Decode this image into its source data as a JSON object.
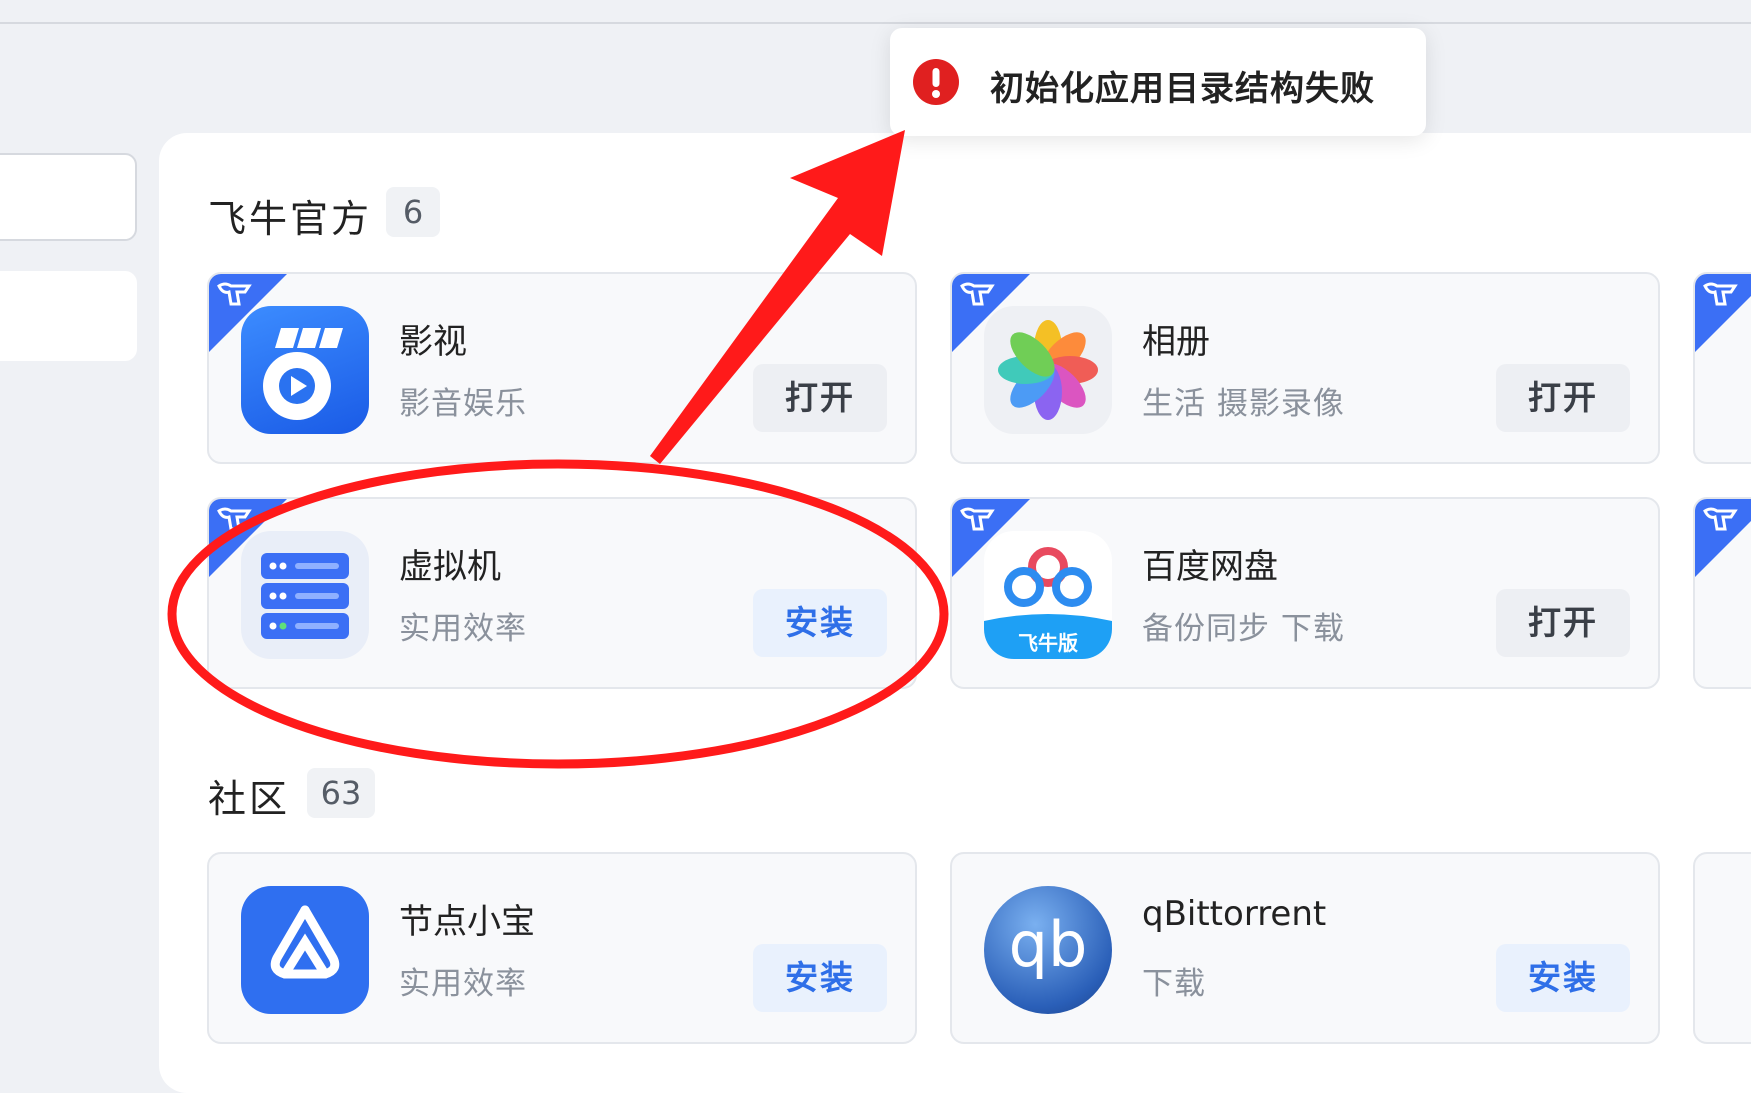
{
  "toast": {
    "icon": "error-icon",
    "message": "初始化应用目录结构失败",
    "accent": "#e02020"
  },
  "sections": {
    "official": {
      "title": "飞牛官方",
      "count": "6"
    },
    "community": {
      "title": "社区",
      "count": "63"
    }
  },
  "apps": {
    "video": {
      "name": "影视",
      "category": "影音娱乐",
      "button": "打开",
      "icon": "video-app-icon"
    },
    "album": {
      "name": "相册",
      "category": "生活 摄影录像",
      "button": "打开",
      "icon": "photos-app-icon"
    },
    "vm": {
      "name": "虚拟机",
      "category": "实用效率",
      "button": "安装",
      "icon": "server-app-icon"
    },
    "baidu": {
      "name": "百度网盘",
      "category": "备份同步 下载",
      "button": "打开",
      "icon": "baidu-netdisk-icon",
      "badge": "飞牛版"
    },
    "node": {
      "name": "节点小宝",
      "category": "实用效率",
      "button": "安装",
      "icon": "node-app-icon"
    },
    "qbit": {
      "name": "qBittorrent",
      "category": "下载",
      "button": "安装",
      "icon": "qbittorrent-icon",
      "logo_text": "qb"
    }
  },
  "colors": {
    "accent_blue": "#3b6ff5",
    "annotation_red": "#ff1a1a"
  }
}
